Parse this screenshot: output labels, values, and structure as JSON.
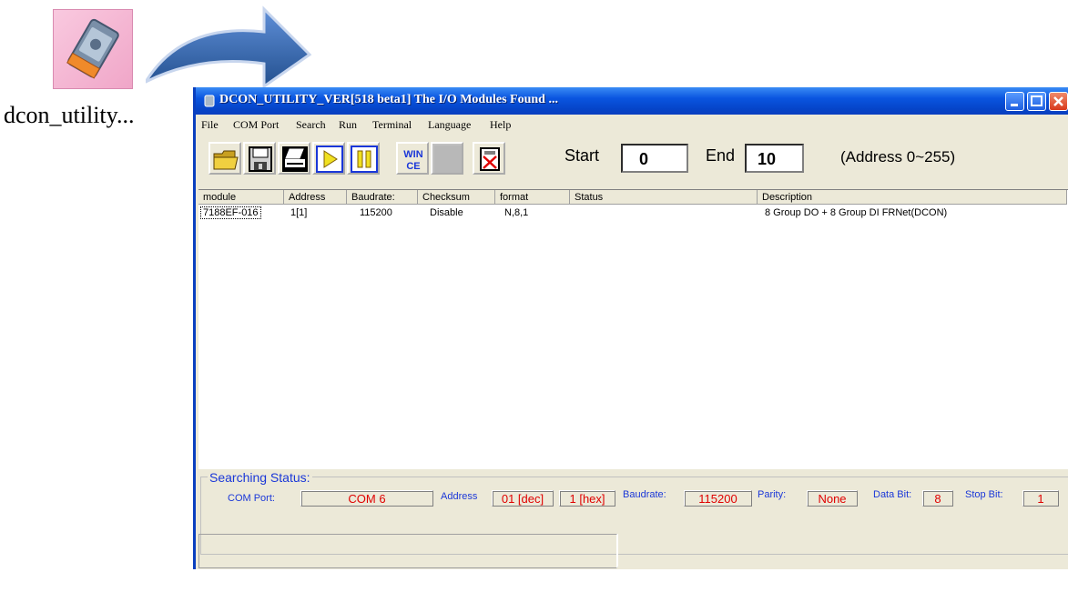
{
  "desktop": {
    "icon_label": "dcon_utility..."
  },
  "window": {
    "title": "DCON_UTILITY_VER[518  beta1] The I/O Modules Found ...",
    "menu": [
      "File",
      "COM Port",
      "Search",
      "Run",
      "Terminal",
      "Language",
      "Help"
    ],
    "toolbar": {
      "tools": [
        "open-folder-icon",
        "save-disk-icon",
        "print-icon",
        "run-icon",
        "pause-icon",
        "wince-icon",
        "blank-icon",
        "terminal-icon"
      ],
      "wince_label_1": "WIN",
      "wince_label_2": "CE",
      "start_label": "Start",
      "start_value": "0",
      "end_label": "End",
      "end_value": "10",
      "address_hint": "(Address 0~255)"
    },
    "list": {
      "columns": [
        "module",
        "Address",
        "Baudrate:",
        "Checksum",
        "format",
        "Status",
        "Description"
      ],
      "rows": [
        {
          "module": "7188EF-016",
          "address": "1[1]",
          "baudrate": "115200",
          "checksum": "Disable",
          "format": "N,8,1",
          "status": "",
          "description": "8 Group DO + 8 Group DI FRNet(DCON)"
        }
      ]
    },
    "searching_status": {
      "title": "Searching Status:",
      "com_port_label": "COM Port:",
      "com_port_value": "COM 6",
      "address_label": "Address",
      "address_dec": "01 [dec]",
      "address_hex": "1 [hex]",
      "baudrate_label": "Baudrate:",
      "baudrate_value": "115200",
      "parity_label": "Parity:",
      "parity_value": "None",
      "data_bit_label": "Data Bit:",
      "data_bit_value": "8",
      "stop_bit_label": "Stop Bit:",
      "stop_bit_value": "1"
    }
  },
  "colors": {
    "title_bar": "#0a55e0",
    "status_label": "#1a37d8",
    "status_value": "#e00000",
    "icon_bg": "#f0a6c8"
  }
}
